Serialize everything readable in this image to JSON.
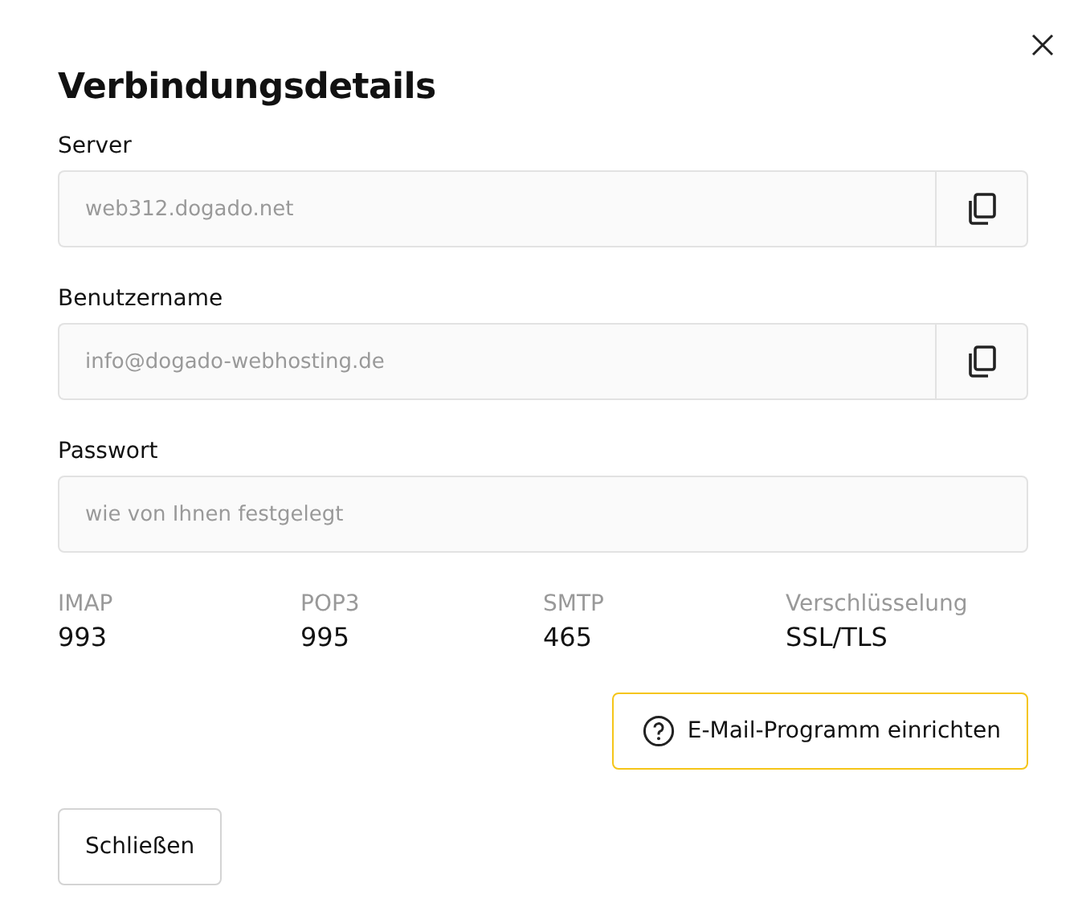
{
  "dialog": {
    "title": "Verbindungsdetails"
  },
  "fields": [
    {
      "label": "Server",
      "value": "web312.dogado.net",
      "copyable": true
    },
    {
      "label": "Benutzername",
      "value": "info@dogado-webhosting.de",
      "copyable": true
    },
    {
      "label": "Passwort",
      "value": "wie von Ihnen festgelegt",
      "copyable": false
    }
  ],
  "ports": [
    {
      "label": "IMAP",
      "value": "993"
    },
    {
      "label": "POP3",
      "value": "995"
    },
    {
      "label": "SMTP",
      "value": "465"
    },
    {
      "label": "Verschlüsselung",
      "value": "SSL/TLS"
    }
  ],
  "setup_button": "E-Mail-Programm einrichten",
  "close_button": "Schließen"
}
